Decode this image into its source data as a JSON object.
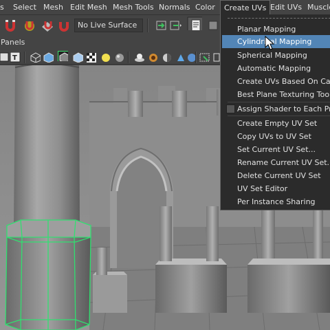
{
  "menubar": {
    "items": [
      "s",
      "Select",
      "Mesh",
      "Edit Mesh",
      "Mesh Tools",
      "Normals",
      "Color",
      "Create UVs",
      "Edit UVs",
      "Muscle"
    ]
  },
  "toolbar": {
    "live_surface": "No Live Surface"
  },
  "panels": {
    "label": "Panels"
  },
  "create_uvs_menu": {
    "items": [
      "Planar Mapping",
      "Cylindrical Mapping",
      "Spherical Mapping",
      "Automatic Mapping",
      "Create UVs Based On Camera",
      "Best Plane Texturing Tool",
      "Assign Shader to Each Projection",
      "Create Empty UV Set",
      "Copy UVs to UV Set",
      "Set Current UV Set...",
      "Rename Current UV Set...",
      "Delete Current UV Set",
      "UV Set Editor",
      "Per Instance Sharing"
    ],
    "highlighted": "Cylindrical Mapping"
  },
  "colors": {
    "menu_bg": "#2b2b2b",
    "highlight": "#5285b6",
    "selection_wire": "#30e070",
    "ui_bg": "#444444"
  }
}
